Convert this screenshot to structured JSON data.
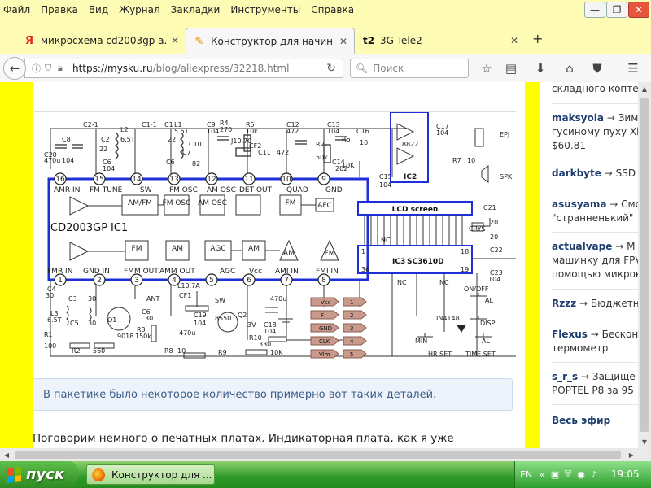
{
  "menu": {
    "items": [
      "Файл",
      "Правка",
      "Вид",
      "Журнал",
      "Закладки",
      "Инструменты",
      "Справка"
    ]
  },
  "tabs": [
    {
      "icon": "yandex-icon",
      "favicon_text": "Я",
      "title": "микросхема cd2003gp а...",
      "active": false
    },
    {
      "icon": "pencil-icon",
      "favicon_text": "✎",
      "title": "Конструктор для начин...",
      "active": true
    },
    {
      "icon": "tele2-icon",
      "favicon_text": "t2",
      "title": "3G Tele2",
      "active": false
    }
  ],
  "toolbar": {
    "url_host": "https://mysku.ru",
    "url_path": "/blog/aliexpress/32218.html",
    "search_placeholder": "Поиск"
  },
  "schematic": {
    "chip_main": "CD2003GP",
    "chip_main_ic": "IC1",
    "chip_lcd": "IC3",
    "chip_lcd_name": "SC3610D",
    "lcd_label": "LCD screen",
    "ic2": "IC2",
    "ic2_part": "8822",
    "pin_top_numbers": [
      "16",
      "15",
      "14",
      "13",
      "12",
      "11",
      "10",
      "9"
    ],
    "pin_top_labels": [
      "AMR IN",
      "FM TUNE",
      "SW",
      "FM OSC",
      "AM OSC",
      "DET OUT",
      "QUAD",
      "GND"
    ],
    "pin_bottom_numbers": [
      "1",
      "2",
      "3",
      "4",
      "5",
      "6",
      "7",
      "8"
    ],
    "pin_bottom_labels": [
      "FMR IN",
      "GND IN",
      "FMM OUT",
      "AMM OUT",
      "AGC",
      "Vcc",
      "AMI IN",
      "FMI IN"
    ],
    "blocks_upper": [
      "AM/FM",
      "FM OSC",
      "AM OSC",
      "FM",
      "AFC"
    ],
    "blocks_lower": [
      "FM",
      "AM",
      "AGC",
      "AM",
      "AM",
      "FM"
    ],
    "connector_labels": [
      "Vcc",
      "F",
      "GND",
      "CLK",
      "Vlm"
    ],
    "connector_numbers": [
      "1",
      "2",
      "3",
      "4",
      "5"
    ],
    "button_labels": [
      "ON/OFF",
      "AL",
      "DISP",
      "MIN",
      "HR SET",
      "AL",
      "TIME SET"
    ],
    "parts": [
      "C20",
      "C8",
      "C2-1",
      "C2",
      "L2",
      "C1-1",
      "C1",
      "L1",
      "C9",
      "R4",
      "R5",
      "C12",
      "C13",
      "C16",
      "C17",
      "C11",
      "C10",
      "Rv",
      "R6",
      "C14",
      "C15",
      "R7",
      "C7",
      "C6",
      "C3",
      "C4",
      "C5",
      "L3",
      "Q1",
      "R1",
      "R2",
      "R3",
      "ANT",
      "CF1",
      "CF2",
      "C19",
      "Q2",
      "SW",
      "R8",
      "R9",
      "R10",
      "C18",
      "C21",
      "C22",
      "C23",
      "CRYS",
      "EPJ",
      "SPK",
      "IN4148",
      "NC"
    ],
    "values": [
      "470u",
      "104",
      "22",
      "6.5T",
      "5.5T",
      "82",
      "270",
      "10k",
      "472",
      "104",
      "50k",
      "10",
      "202",
      "10K",
      "104",
      "9018",
      "150k",
      "560",
      "100",
      "8550",
      "330",
      "3V",
      "10K",
      "20",
      "J10.7C",
      "L10.7A"
    ]
  },
  "caption": "В пакетике было некоторое количество примерно вот таких деталей.",
  "paragraph": "Поговорим немного о печатных платах. Индикаторная плата, как я уже",
  "sidebar": {
    "entries": [
      {
        "user": "",
        "target": "складного коптера"
      },
      {
        "user": "maksyola",
        "target": "Зим",
        "extra": "гусиному пуху Xia",
        "extra2": "$60.81"
      },
      {
        "user": "darkbyte",
        "target": "SSD"
      },
      {
        "user": "asusyama",
        "target": "Смо",
        "extra": "\"странненький\" т"
      },
      {
        "user": "actualvape",
        "target": "М",
        "extra": "машинку для FPV",
        "extra2": "помощью микрок"
      },
      {
        "user": "Rzzz",
        "target": "Бюджетн"
      },
      {
        "user": "Flexus",
        "target": "Бескон",
        "extra": "термометр"
      },
      {
        "user": "s_r_s",
        "target": "Защище",
        "extra": "POPTEL P8 за 95"
      }
    ],
    "live": "Весь эфир"
  },
  "taskbar": {
    "start": "пуск",
    "window": "Конструктор для ...",
    "lang": "EN",
    "time": "19:05"
  },
  "colors": {
    "menubar": "#fefcb4",
    "page_bg": "#ffff00",
    "taskbar": "#2e9a28",
    "schematic_blue": "#1f2fd8",
    "connector_brown": "#b07a6a"
  }
}
